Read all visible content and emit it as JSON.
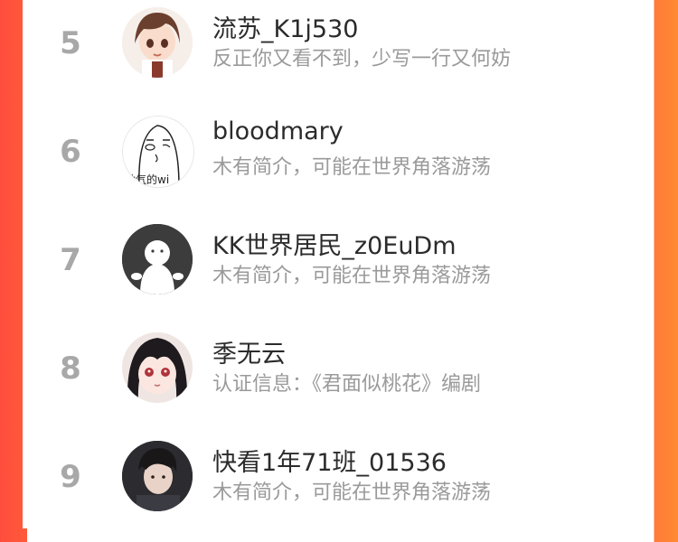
{
  "ranking": {
    "rows": [
      {
        "rank": "5",
        "name": "流苏_K1j530",
        "desc": "反正你又看不到，少写一行又何妨",
        "avatar": "anime-girl-avatar"
      },
      {
        "rank": "6",
        "name": "bloodmary",
        "desc": "木有简介，可能在世界角落游荡",
        "avatar": "sketch-doodle-avatar",
        "avatar_text": "动气的wi"
      },
      {
        "rank": "7",
        "name": "KK世界居民_z0EuDm",
        "desc": "木有简介，可能在世界角落游荡",
        "avatar": "default-ghost-avatar"
      },
      {
        "rank": "8",
        "name": "季无云",
        "desc": "认证信息：《君面似桃花》编剧",
        "avatar": "anime-boy-avatar"
      },
      {
        "rank": "9",
        "name": "快看1年71班_01536",
        "desc": "木有简介，可能在世界角落游荡",
        "avatar": "photo-man-avatar"
      }
    ]
  },
  "colors": {
    "accent_left": "#ff4d3d",
    "accent_right": "#ff8a33",
    "rank": "#a8a8a8",
    "name": "#2b2b2b",
    "desc": "#9a9a9a"
  }
}
